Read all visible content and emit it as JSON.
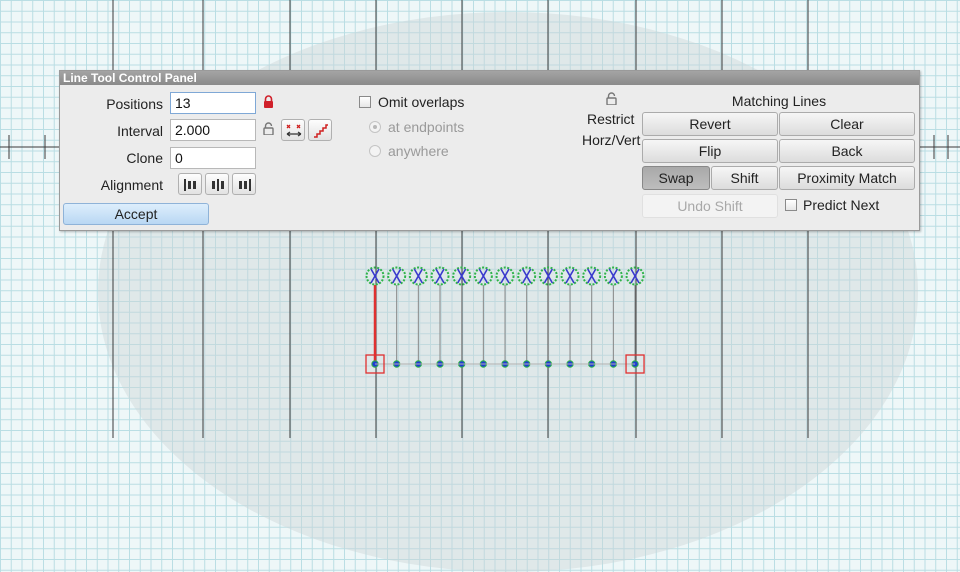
{
  "panel": {
    "title": "Line Tool Control Panel",
    "positions": {
      "label": "Positions",
      "value": "13",
      "lock_icon": "lock-closed-icon",
      "lock_color": "#d0202a"
    },
    "interval": {
      "label": "Interval",
      "value": "2.000",
      "lock_icon": "lock-open-icon"
    },
    "clone": {
      "label": "Clone",
      "value": "0"
    },
    "alignment": {
      "label": "Alignment",
      "icons": [
        "align-left-icon",
        "align-center-icon",
        "align-right-icon"
      ]
    },
    "accept_label": "Accept",
    "omit_overlaps": {
      "label": "Omit overlaps",
      "checked": false
    },
    "radio_endpoints": "at endpoints",
    "radio_anywhere": "anywhere",
    "restrict": {
      "icon": "lock-open-icon",
      "label": "Restrict",
      "sub_label": "Horz/Vert"
    },
    "matching": {
      "header": "Matching Lines",
      "revert": "Revert",
      "clear": "Clear",
      "flip": "Flip",
      "back": "Back",
      "swap": "Swap",
      "shift": "Shift",
      "proximity_match": "Proximity Match",
      "undo_shift": "Undo Shift",
      "predict_next": "Predict Next"
    }
  },
  "canvas": {
    "count": 13,
    "colors": {
      "background": "#eef7f8",
      "grid": "#b9dde3",
      "major_line": "#3a3a3a",
      "ring": "#2fb34a",
      "cross": "#3a3acd",
      "dot": "#1f3fd0",
      "selection": "#e03030"
    }
  }
}
